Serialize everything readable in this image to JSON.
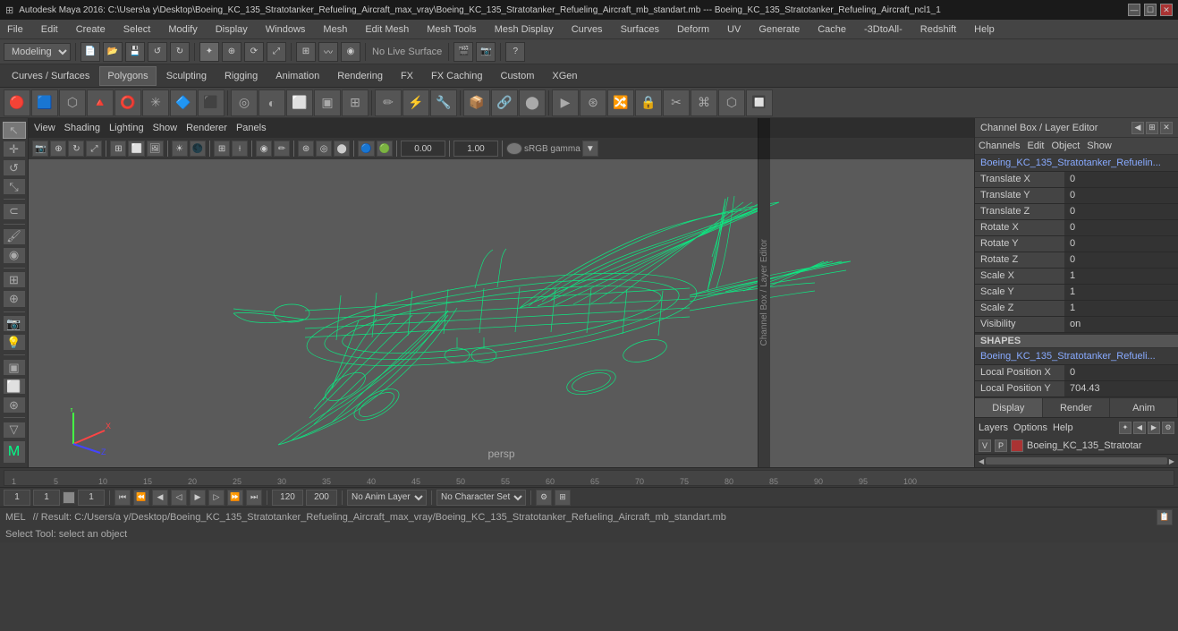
{
  "titleBar": {
    "title": "Autodesk Maya 2016: C:\\Users\\a y\\Desktop\\Boeing_KC_135_Stratotanker_Refueling_Aircraft_max_vray\\Boeing_KC_135_Stratotanker_Refueling_Aircraft_mb_standart.mb  ---  Boeing_KC_135_Stratotanker_Refueling_Aircraft_ncl1_1",
    "minimizeLabel": "—",
    "maximizeLabel": "☐",
    "closeLabel": "✕"
  },
  "menuBar": {
    "items": [
      "File",
      "Edit",
      "Create",
      "Select",
      "Modify",
      "Display",
      "Windows",
      "Mesh",
      "Edit Mesh",
      "Mesh Tools",
      "Mesh Display",
      "Curves",
      "Surfaces",
      "Deform",
      "UV",
      "Generate",
      "Cache",
      "-3DtoAll-",
      "Redshift",
      "Help"
    ]
  },
  "toolbar1": {
    "mode": "Modeling",
    "liveLabel": "No Live Surface",
    "colorLabel": "sRGB gamma"
  },
  "shelfTabs": {
    "tabs": [
      "Curves / Surfaces",
      "Polygons",
      "Sculpting",
      "Rigging",
      "Animation",
      "Rendering",
      "FX",
      "FX Caching",
      "Custom",
      "XGen"
    ],
    "activeIndex": 1
  },
  "viewportHeader": {
    "menuItems": [
      "View",
      "Shading",
      "Lighting",
      "Show",
      "Renderer",
      "Panels"
    ]
  },
  "viewportLabel": "persp",
  "rightPanel": {
    "header": "Channel Box / Layer Editor",
    "channels": {
      "menuItems": [
        "Channels",
        "Edit",
        "Object",
        "Show"
      ],
      "objectName": "Boeing_KC_135_Stratotanker_Refuelin...",
      "rows": [
        {
          "label": "Translate X",
          "value": "0"
        },
        {
          "label": "Translate Y",
          "value": "0"
        },
        {
          "label": "Translate Z",
          "value": "0"
        },
        {
          "label": "Rotate X",
          "value": "0"
        },
        {
          "label": "Rotate Y",
          "value": "0"
        },
        {
          "label": "Rotate Z",
          "value": "0"
        },
        {
          "label": "Scale X",
          "value": "1"
        },
        {
          "label": "Scale Y",
          "value": "1"
        },
        {
          "label": "Scale Z",
          "value": "1"
        },
        {
          "label": "Visibility",
          "value": "on"
        }
      ]
    },
    "shapes": {
      "header": "SHAPES",
      "objectName": "Boeing_KC_135_Stratotanker_Refueli...",
      "rows": [
        {
          "label": "Local Position X",
          "value": "0"
        },
        {
          "label": "Local Position Y",
          "value": "704.43"
        }
      ]
    },
    "bottomTabs": [
      "Display",
      "Render",
      "Anim"
    ],
    "activeBottomTab": 0,
    "layerBar": {
      "menuItems": [
        "Layers",
        "Options",
        "Help"
      ]
    },
    "layerItem": {
      "v": "V",
      "p": "P",
      "name": "Boeing_KC_135_Stratotar"
    }
  },
  "animControls": {
    "frame1": "1",
    "frame2": "1",
    "frameRange1": "1",
    "frameEnd": "120",
    "currentFrame": "120",
    "rangeEnd": "200",
    "noAnimLayer": "No Anim Layer",
    "noCharSet": "No Character Set"
  },
  "statusBar": {
    "mode": "MEL",
    "result": "// Result: C:/Users/a y/Desktop/Boeing_KC_135_Stratotanker_Refueling_Aircraft_max_vray/Boeing_KC_135_Stratotanker_Refueling_Aircraft_mb_standart.mb"
  },
  "helpLine": {
    "text": "Select Tool: select an object"
  },
  "vcControls": {
    "value1": "0.00",
    "value2": "1.00",
    "colorMode": "sRGB gamma"
  }
}
